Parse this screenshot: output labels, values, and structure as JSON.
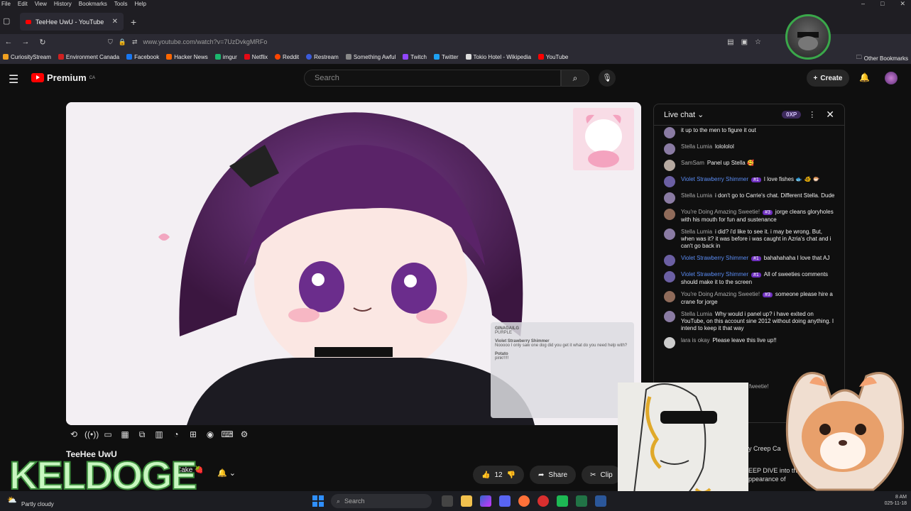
{
  "menubar": {
    "items": [
      "File",
      "Edit",
      "View",
      "History",
      "Bookmarks",
      "Tools",
      "Help"
    ]
  },
  "window_controls": {
    "minimize": "–",
    "maximize": "□",
    "close": "✕"
  },
  "browser": {
    "tab_title": "TeeHee UwU - YouTube",
    "tab_close": "✕",
    "new_tab": "+",
    "url": "www.youtube.com/watch?v=7UzDvkgMRFo",
    "bookmarks": [
      {
        "label": "CuriosityStream",
        "color": "#f0a020"
      },
      {
        "label": "Environment Canada",
        "color": "#d02020"
      },
      {
        "label": "Facebook",
        "color": "#1877f2"
      },
      {
        "label": "Hacker News",
        "color": "#ff6600"
      },
      {
        "label": "imgur",
        "color": "#1bb76e"
      },
      {
        "label": "Netflix",
        "color": "#e50914"
      },
      {
        "label": "Reddit",
        "color": "#ff4500"
      },
      {
        "label": "Restream",
        "color": "#3b5bdb"
      },
      {
        "label": "Something Awful",
        "color": "#888888"
      },
      {
        "label": "Twitch",
        "color": "#9146ff"
      },
      {
        "label": "Twitter",
        "color": "#1da1f2"
      },
      {
        "label": "Tokio Hotel - Wikipedia",
        "color": "#dddddd"
      },
      {
        "label": "YouTube",
        "color": "#ff0000"
      }
    ],
    "other_bookmarks": "Other Bookmarks"
  },
  "youtube": {
    "logo_text": "Premium",
    "logo_region": "CA",
    "search_placeholder": "Search",
    "create_label": "Create",
    "video_title": "TeeHee UwU",
    "channel_partial": "Cake 🍓",
    "like_count": "12",
    "share_label": "Share",
    "clip_label": "Clip"
  },
  "live_chat": {
    "title": "Live chat",
    "xp_badge": "0XP",
    "messages": [
      {
        "author": "",
        "badge": "",
        "text": "it up to the men to figure it out",
        "blue": false
      },
      {
        "author": "Stella Lumia",
        "badge": "",
        "text": "lolololol",
        "blue": false
      },
      {
        "author": "SamSam",
        "badge": "",
        "text": "Panel up Stella 🥰",
        "blue": false
      },
      {
        "author": "Violet Strawberry Shimmer",
        "badge": "#1",
        "text": "I love fishes 🐟 🐠 🐡",
        "blue": true
      },
      {
        "author": "Stella Lumia",
        "badge": "",
        "text": "i don't go to Carrie's chat. Different Stella. Dude",
        "blue": false
      },
      {
        "author": "You're Doing Amazing Sweetie!",
        "badge": "#3",
        "text": "jorge cleans gloryholes with his mouth for fun and sustenance",
        "blue": false
      },
      {
        "author": "Stella Lumia",
        "badge": "",
        "text": "i did? i'd like to see it. i may be wrong. But, when was it? it was before i was caught in Azria's chat and i can't go back in",
        "blue": false
      },
      {
        "author": "Violet Strawberry Shimmer",
        "badge": "#1",
        "text": "bahahahaha I love that AJ",
        "blue": true
      },
      {
        "author": "Violet Strawberry Shimmer",
        "badge": "#1",
        "text": "All of sweeties comments should make it to the screen",
        "blue": true
      },
      {
        "author": "You're Doing Amazing Sweetie!",
        "badge": "#3",
        "text": "someone please hire a crane for jorge",
        "blue": false
      },
      {
        "author": "Stella Lumia",
        "badge": "",
        "text": "Why would i panel up? i have exited on YouTube, on this account sine 2012 without doing anything. I intend to keep it that way",
        "blue": false
      },
      {
        "author": "lara is okay",
        "badge": "",
        "text": "Please leave this live up!!",
        "blue": false
      }
    ]
  },
  "overlay_chat": [
    {
      "author": "GINAGAILG",
      "text": "PURPLE"
    },
    {
      "author": "Violet Strawberry Shimmer",
      "text": "Nooooo I only saw one dog did you get it what do you need help with?"
    },
    {
      "author": "Potato",
      "text": "pink!!!!!"
    }
  ],
  "stream_overlay": {
    "streamer_name": "KELDOGE",
    "partial_text_1": "y Creep Ca",
    "partial_text_2": "EEP DIVE into th",
    "partial_text_3": "ppearance of",
    "partial_text_4": "fweetie!"
  },
  "taskbar": {
    "weather": "Partly cloudy",
    "search_placeholder": "Search",
    "time": "8 AM",
    "date": "025-11-18"
  },
  "colors": {
    "accent": "#ff0000",
    "chat_blue": "#5b8df5",
    "badge_purple": "#6e2fbf",
    "kel_green": "#3a8a3a"
  }
}
